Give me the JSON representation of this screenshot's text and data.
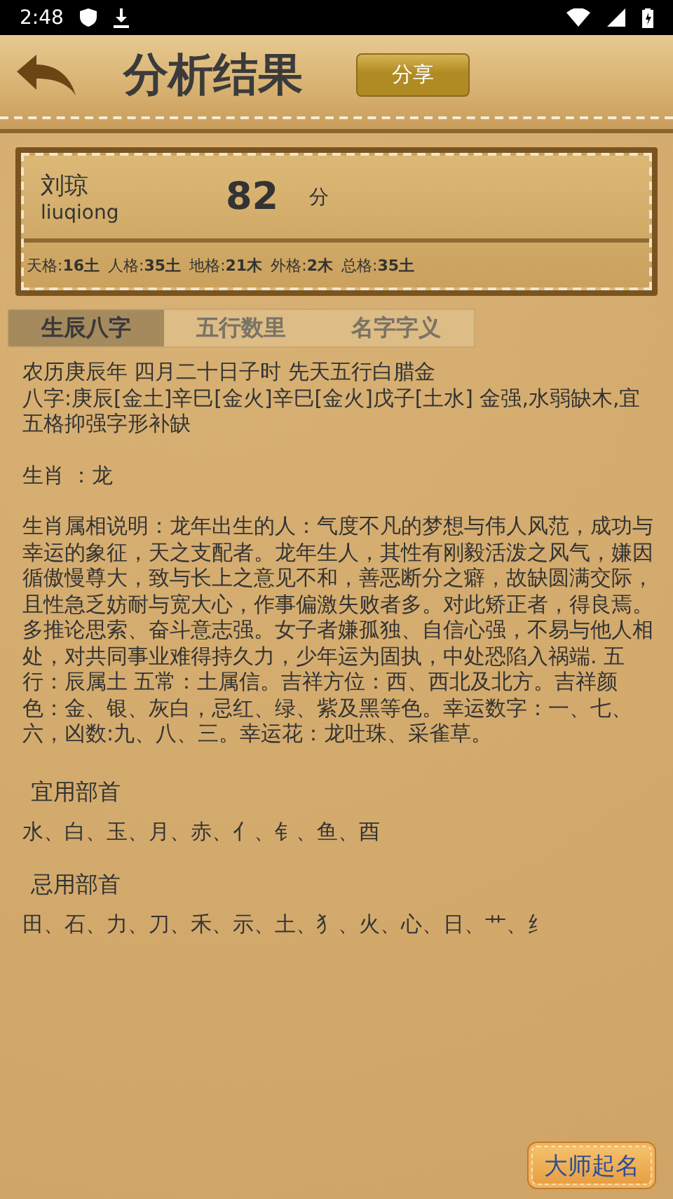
{
  "status_bar": {
    "time": "2:48"
  },
  "header": {
    "title": "分析结果",
    "share_button": "分享"
  },
  "card": {
    "name": "刘琼",
    "pinyin": "liuqiong",
    "score": "82",
    "score_unit": "分",
    "grids": [
      "天格:**16土**",
      "人格:**35土**",
      "地格:**21木**",
      "外格:**2木**",
      "总格:**35土**"
    ]
  },
  "tabs": [
    {
      "label": "生辰八字",
      "selected": true
    },
    {
      "label": "五行数里",
      "selected": false
    },
    {
      "label": "名字字义",
      "selected": false
    }
  ],
  "blocks": [
    {
      "lines": [
        "农历庚辰年 四月二十日子时 先天五行白腊金",
        "八字:庚辰[金土]辛巳[金火]辛巳[金火]戊子[土水] 金强,水弱缺木,宜五格抑强字形补缺"
      ]
    },
    {
      "lines": [
        "生肖 ：龙"
      ]
    },
    {
      "lines": [
        "生肖属相说明：龙年出生的人：气度不凡的梦想与伟人风范，成功与幸运的象征，天之支配者。龙年生人，其性有刚毅活泼之风气，嫌因循傲慢尊大，致与长上之意见不和，善恶断分之癖，故缺圆满交际，且性急乏妨耐与宽大心，作事偏激失败者多。对此矫正者，得良焉。多推论思索、奋斗意志强。女子者嫌孤独、自信心强，不易与他人相处，对共同事业难得持久力，少年运为固执，中处恐陷入祸端. 五行：辰属土 五常：土属信。吉祥方位：西、西北及北方。吉祥颜色：金、银、灰白，忌红、绿、紫及黑等色。幸运数字：一、七、六，凶数:九、八、三。幸运花：龙吐珠、采雀草。"
      ]
    }
  ],
  "radical_sections": [
    {
      "heading": "宜用部首",
      "items": "水、白、玉、月、赤、亻、钅、鱼、酉"
    },
    {
      "heading": "忌用部首",
      "items": "田、石、力、刀、禾、示、土、犭、火、心、日、艹、纟"
    }
  ],
  "master_button": "大师起名"
}
